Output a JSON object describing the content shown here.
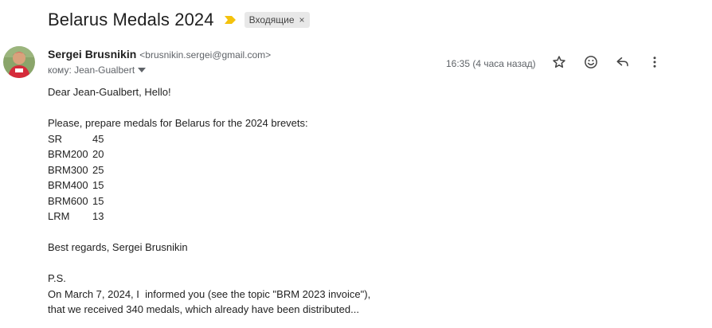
{
  "email": {
    "subject": "Belarus Medals 2024",
    "label": "Входящие",
    "label_remove": "×",
    "sender": {
      "name": "Sergei Brusnikin",
      "email": "<brusnikin.sergei@gmail.com>"
    },
    "to_line": "кому: Jean-Gualbert",
    "time": "16:35 (4 часа назад)",
    "body": {
      "greeting": "Dear Jean-Gualbert, Hello!",
      "intro": "Please, prepare medals for Belarus for the 2024 brevets:",
      "medals": [
        {
          "type": "SR",
          "count": "45"
        },
        {
          "type": "BRM200",
          "count": "20"
        },
        {
          "type": "BRM300",
          "count": "25"
        },
        {
          "type": "BRM400",
          "count": "15"
        },
        {
          "type": "BRM600",
          "count": "15"
        },
        {
          "type": "LRM",
          "count": "13"
        }
      ],
      "regards": "Best regards, Sergei Brusnikin",
      "ps_label": "P.S.",
      "ps_line1": "On March 7, 2024, I  informed you (see the topic \"BRM 2023 invoice\"),",
      "ps_line2": "that we received 340 medals, which already have been distributed..."
    }
  },
  "icons": {
    "importance": "importance-marker-icon",
    "star": "star-icon",
    "emoji": "emoji-reaction-icon",
    "reply": "reply-icon",
    "more": "more-vert-icon"
  },
  "colors": {
    "importance": "#f4c20d",
    "label_bg": "#e8e8e8",
    "secondary_text": "#5f6368"
  }
}
